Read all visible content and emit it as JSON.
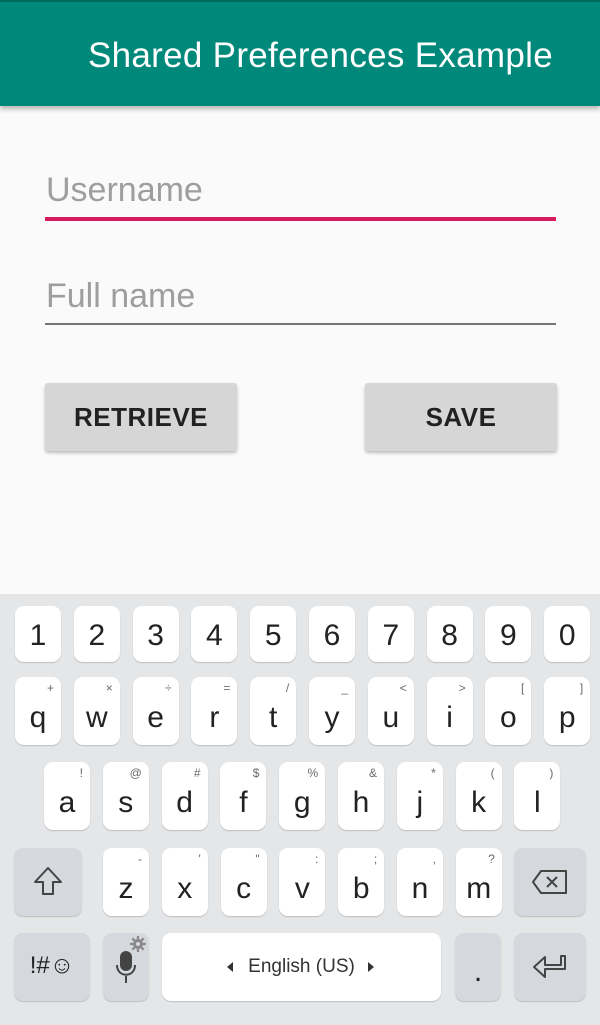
{
  "app_bar": {
    "title": "Shared Preferences Example"
  },
  "form": {
    "username_placeholder": "Username",
    "fullname_placeholder": "Full name"
  },
  "buttons": {
    "retrieve": "RETRIEVE",
    "save": "SAVE"
  },
  "keyboard": {
    "number_row": [
      "1",
      "2",
      "3",
      "4",
      "5",
      "6",
      "7",
      "8",
      "9",
      "0"
    ],
    "row1": [
      {
        "main": "q",
        "sub": "+"
      },
      {
        "main": "w",
        "sub": "×"
      },
      {
        "main": "e",
        "sub": "÷"
      },
      {
        "main": "r",
        "sub": "="
      },
      {
        "main": "t",
        "sub": "/"
      },
      {
        "main": "y",
        "sub": "_"
      },
      {
        "main": "u",
        "sub": "<"
      },
      {
        "main": "i",
        "sub": ">"
      },
      {
        "main": "o",
        "sub": "["
      },
      {
        "main": "p",
        "sub": "]"
      }
    ],
    "row2": [
      {
        "main": "a",
        "sub": "!"
      },
      {
        "main": "s",
        "sub": "@"
      },
      {
        "main": "d",
        "sub": "#"
      },
      {
        "main": "f",
        "sub": "$"
      },
      {
        "main": "g",
        "sub": "%"
      },
      {
        "main": "h",
        "sub": "&"
      },
      {
        "main": "j",
        "sub": "*"
      },
      {
        "main": "k",
        "sub": "("
      },
      {
        "main": "l",
        "sub": ")"
      }
    ],
    "row3": [
      {
        "main": "z",
        "sub": "-"
      },
      {
        "main": "x",
        "sub": "'"
      },
      {
        "main": "c",
        "sub": "\""
      },
      {
        "main": "v",
        "sub": ":"
      },
      {
        "main": "b",
        "sub": ";"
      },
      {
        "main": "n",
        "sub": ","
      },
      {
        "main": "m",
        "sub": "?"
      }
    ],
    "symbols_label": "!#☺",
    "space_label": "English (US)",
    "period_label": ".",
    "icons": {
      "shift": "shift-icon",
      "backspace": "backspace-icon",
      "mic": "microphone-icon",
      "settings": "gear-icon",
      "enter": "enter-icon",
      "left": "chevron-left-icon",
      "right": "chevron-right-icon"
    }
  },
  "colors": {
    "app_bar": "#00897b",
    "accent": "#d81b60",
    "button": "#d6d6d6",
    "keyboard_bg": "#e5e6e8"
  }
}
